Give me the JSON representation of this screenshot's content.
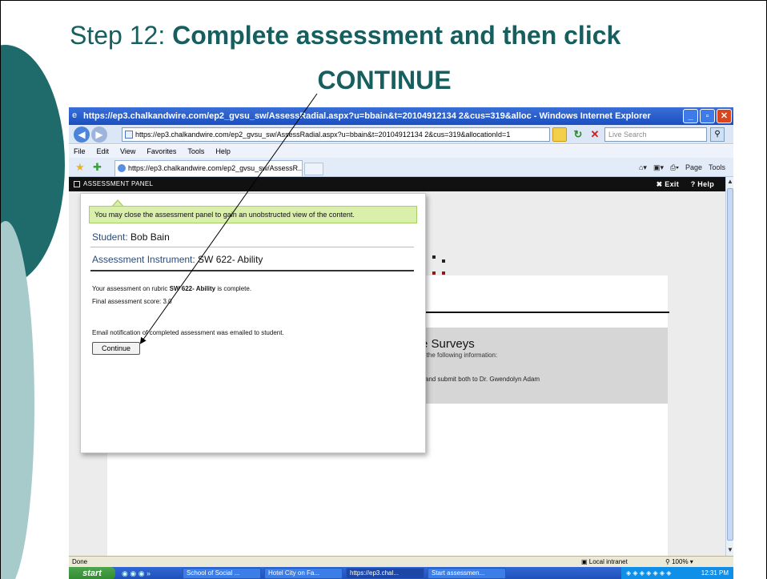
{
  "slide": {
    "title_step": "Step 12",
    "title_colon": ": ",
    "title_bold": "Complete assessment and then click",
    "title_line2": "CONTINUE"
  },
  "colors": {
    "title": "#175f5f",
    "deco_dark": "#1f6b6b",
    "deco_light": "#a7cbcb",
    "notice_bg": "#d9efaa"
  },
  "browser": {
    "window_title": "https://ep3.chalkandwire.com/ep2_gvsu_sw/AssessRadial.aspx?u=bbain&t=20104912134 2&cus=319&alloc - Windows Internet Explorer",
    "address": "https://ep3.chalkandwire.com/ep2_gvsu_sw/AssessRadial.aspx?u=bbain&t=20104912134 2&cus=319&allocationId=1",
    "search_placeholder": "Live Search",
    "menu": [
      "File",
      "Edit",
      "View",
      "Favorites",
      "Tools",
      "Help"
    ],
    "tab_label": "https://ep3.chalkandwire.com/ep2_gvsu_sw/AssessR...",
    "cmd_page": "Page",
    "cmd_tools": "Tools",
    "icons": [
      "back-icon",
      "forward-icon",
      "lock-icon",
      "refresh-icon",
      "stop-icon",
      "search-icon",
      "favorites-star-icon",
      "home-icon",
      "feeds-icon",
      "print-icon"
    ]
  },
  "panel_header": {
    "title": "ASSESSMENT PANEL",
    "exit": "Exit",
    "help": "Help"
  },
  "panel": {
    "notice": "You may close the assessment panel to gain an unobstructed view of the content.",
    "student_label": "Student: ",
    "student_name": "Bob Bain",
    "instrument_label": "Assessment Instrument: ",
    "instrument_name": "SW 622- Ability",
    "line1_pre": "Your assessment on rubric ",
    "line1_rubric": "SW 622- Ability",
    "line1_post": " is complete.",
    "line2": "Final assessment score: 3.0",
    "line3": "Email notification of completed assessment was emailed to student.",
    "continue_label": "Continue"
  },
  "background": {
    "survey_title": "e Surveys",
    "survey_sub": "d the following information:",
    "survey_sub2": "r and submit both to Dr. Gwendolyn Adam"
  },
  "statusbar": {
    "left": "Done",
    "zone": "Local intranet",
    "zoom": "100%"
  },
  "taskbar": {
    "start": "start",
    "tasks": [
      "School of Social ...",
      "Hotel City on Fa...",
      "https://ep3.chal...",
      "Start assessmen..."
    ],
    "clock": "12:31 PM"
  }
}
